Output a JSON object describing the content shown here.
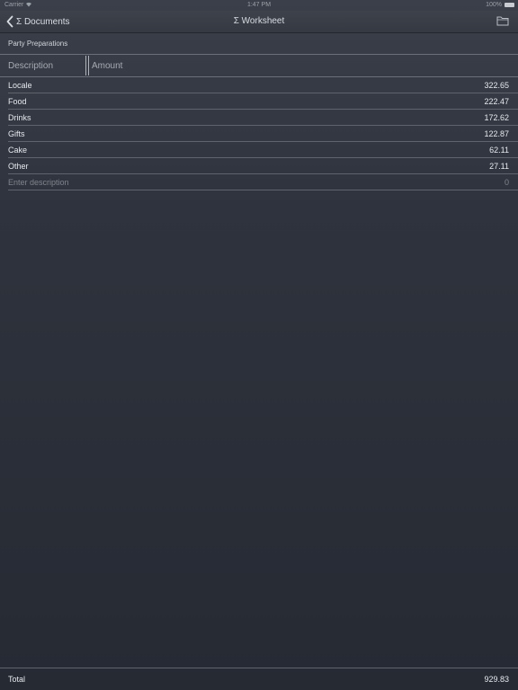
{
  "status_bar": {
    "carrier": "Carrier",
    "time": "1:47 PM",
    "battery": "100%"
  },
  "nav": {
    "back_label": "Σ Documents",
    "title": "Σ Worksheet"
  },
  "sheet": {
    "name": "Party Preparations",
    "columns": {
      "description": "Description",
      "amount": "Amount"
    },
    "rows": [
      {
        "description": "Locale",
        "amount": "322.65"
      },
      {
        "description": "Food",
        "amount": "222.47"
      },
      {
        "description": "Drinks",
        "amount": "172.62"
      },
      {
        "description": "Gifts",
        "amount": "122.87"
      },
      {
        "description": "Cake",
        "amount": "62.11"
      },
      {
        "description": "Other",
        "amount": "27.11"
      }
    ],
    "new_row": {
      "placeholder": "Enter description",
      "amount": "0"
    }
  },
  "footer": {
    "total_label": "Total",
    "total_value": "929.83"
  }
}
